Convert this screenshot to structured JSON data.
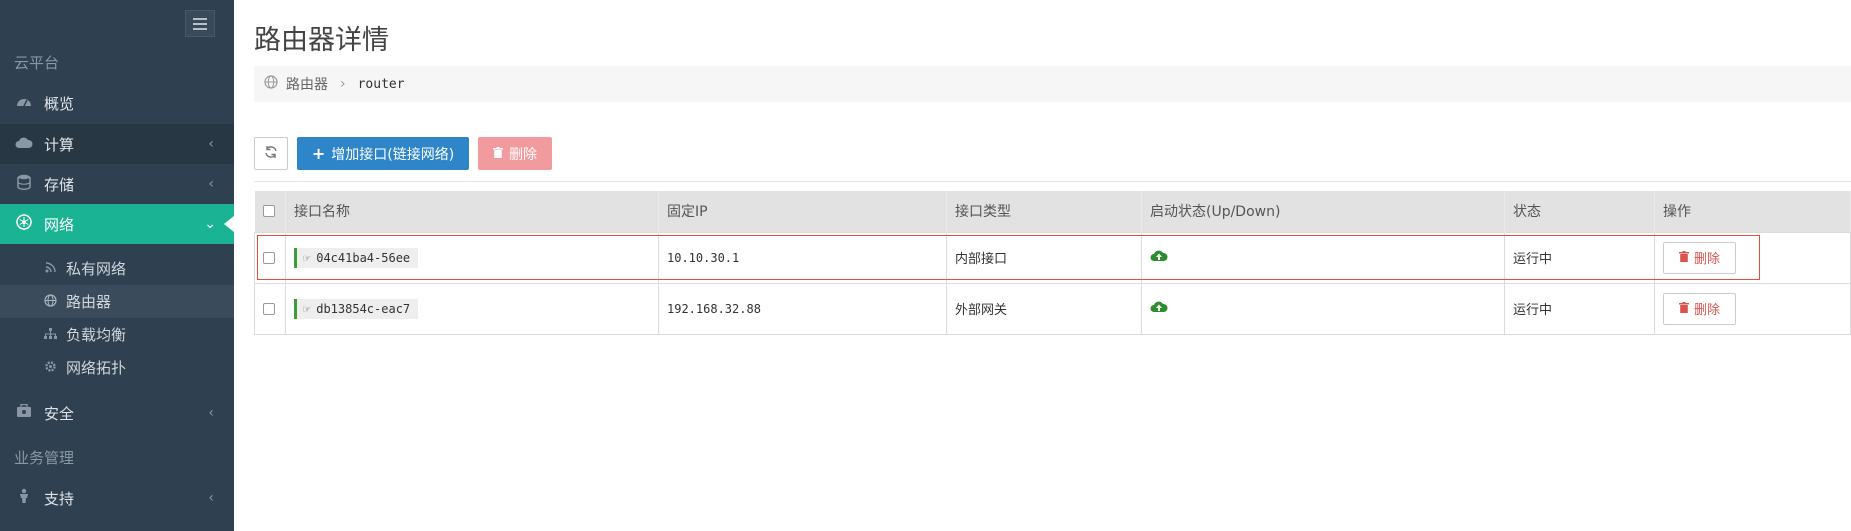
{
  "app": {
    "title": "云平台"
  },
  "sidebar": {
    "section_cloud": "云平台",
    "section_business": "业务管理",
    "items": [
      {
        "label": "概览",
        "icon": "dashboard-icon"
      },
      {
        "label": "计算",
        "icon": "cloud-icon"
      },
      {
        "label": "存储",
        "icon": "database-icon"
      },
      {
        "label": "网络",
        "icon": "network-icon"
      },
      {
        "label": "安全",
        "icon": "briefcase-icon"
      },
      {
        "label": "支持",
        "icon": "person-icon"
      }
    ],
    "network_sub": [
      {
        "label": "私有网络",
        "icon": "rss-icon"
      },
      {
        "label": "路由器",
        "icon": "globe-icon"
      },
      {
        "label": "负载均衡",
        "icon": "sitemap-icon"
      },
      {
        "label": "网络拓扑",
        "icon": "gear-icon"
      }
    ]
  },
  "page": {
    "title": "路由器详情"
  },
  "breadcrumb": {
    "root": "路由器",
    "current": "router"
  },
  "toolbar": {
    "add_label": "增加接口(链接网络)",
    "delete_label": "删除"
  },
  "table": {
    "headers": [
      "接口名称",
      "固定IP",
      "接口类型",
      "启动状态(Up/Down)",
      "状态",
      "操作"
    ],
    "rows": [
      {
        "name": "04c41ba4-56ee",
        "ip": "10.10.30.1",
        "type": "内部接口",
        "status": "运行中",
        "action": "删除"
      },
      {
        "name": "db13854c-eac7",
        "ip": "192.168.32.88",
        "type": "外部网关",
        "status": "运行中",
        "action": "删除"
      }
    ]
  },
  "colors": {
    "sidebar_bg": "#2f4050",
    "active": "#1ab394",
    "primary": "#2e86c9",
    "danger_light": "#f29b9e",
    "up_green": "#2e8b2e",
    "highlight": "#e74c3c"
  }
}
